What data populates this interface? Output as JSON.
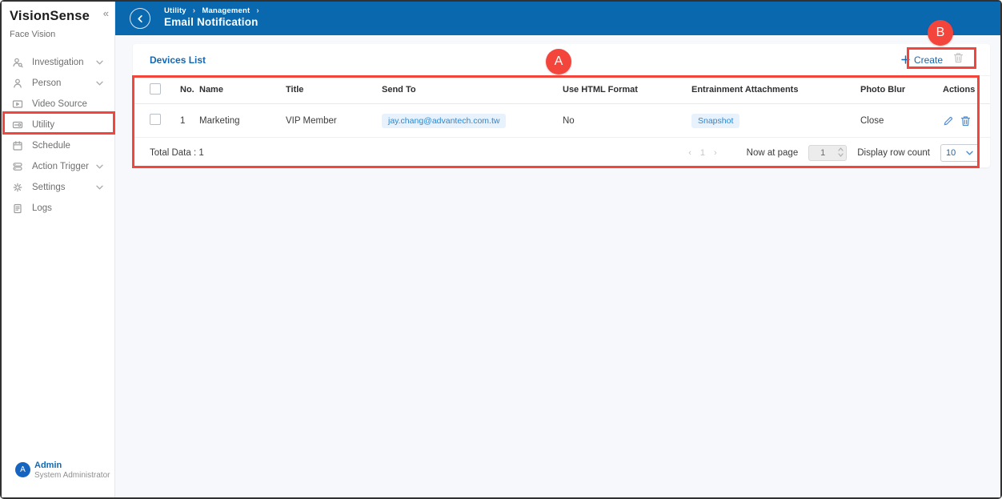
{
  "sidebar": {
    "brand": {
      "title": "VisionSense",
      "subtitle": "Face Vision",
      "collapse_icon": "«"
    },
    "items": [
      {
        "label": "Investigation"
      },
      {
        "label": "Person"
      },
      {
        "label": "Video Source"
      },
      {
        "label": "Utility"
      },
      {
        "label": "Schedule"
      },
      {
        "label": "Action Trigger"
      },
      {
        "label": "Settings"
      },
      {
        "label": "Logs"
      }
    ],
    "user": {
      "avatar_letter": "A",
      "name": "Admin",
      "role": "System Administrator"
    }
  },
  "header": {
    "breadcrumb": {
      "level1": "Utility",
      "sep1": "›",
      "level2": "Management",
      "sep2": "›"
    },
    "title": "Email Notification"
  },
  "panel": {
    "title": "Devices List",
    "create_label": "Create"
  },
  "table": {
    "columns": [
      "No.",
      "Name",
      "Title",
      "Send To",
      "Use HTML Format",
      "Entrainment Attachments",
      "Photo Blur",
      "Actions"
    ],
    "rows": [
      {
        "no": "1",
        "name": "Marketing",
        "title": "VIP Member",
        "send_to": "jay.chang@advantech.com.tw",
        "use_html_format": "No",
        "entrainment_attachments": "Snapshot",
        "photo_blur": "Close"
      }
    ]
  },
  "footer": {
    "total_label": "Total Data : 1",
    "prev": "‹",
    "page": "1",
    "next": "›",
    "now_at_page_label": "Now at page",
    "page_input_value": "1",
    "display_row_count_label": "Display row count",
    "row_count_value": "10"
  },
  "annotations": {
    "circle_a": "A",
    "circle_b": "B"
  },
  "colors": {
    "topbar_blue": "#0a68af",
    "accent_blue": "#1268b3",
    "annotation_red": "#f4453c",
    "chip_bg": "#e7f2fc",
    "chip_text": "#2b87d3"
  }
}
